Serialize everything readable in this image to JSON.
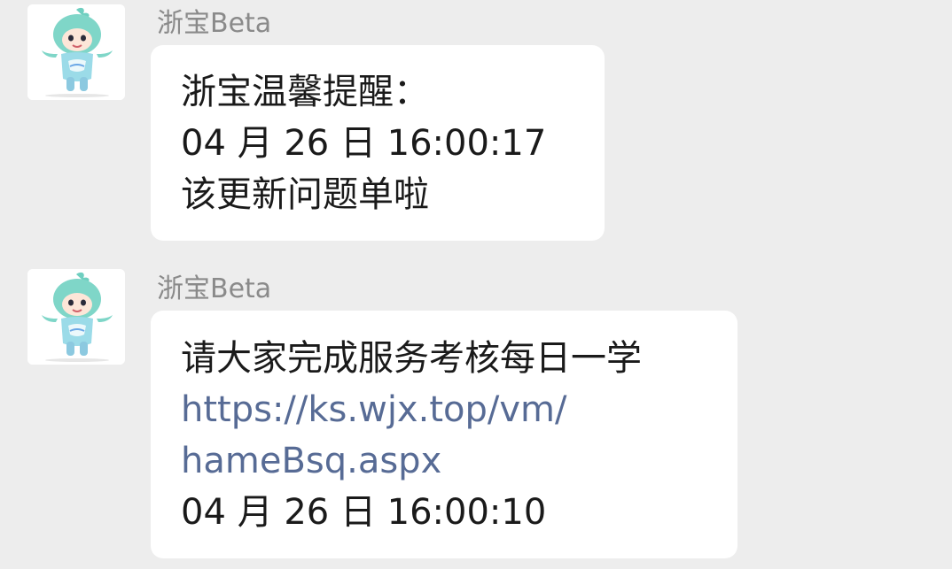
{
  "messages": [
    {
      "sender": "浙宝Beta",
      "avatar_icon": "mascot-avatar-icon",
      "lines": [
        "浙宝温馨提醒：",
        "04 月 26 日 16:00:17",
        "该更新问题单啦"
      ]
    },
    {
      "sender": "浙宝Beta",
      "avatar_icon": "mascot-avatar-icon",
      "lines": [
        "请大家完成服务考核每日一学"
      ],
      "link_lines": [
        "https://ks.wjx.top/vm/",
        "hameBsq.aspx"
      ],
      "trailing_lines": [
        "04 月 26 日 16:00:10"
      ]
    }
  ],
  "colors": {
    "background": "#ededed",
    "bubble": "#ffffff",
    "text": "#1a1a1a",
    "sender": "#8a8a8a",
    "link": "#576b95",
    "mascot": "#7fd6c8"
  }
}
